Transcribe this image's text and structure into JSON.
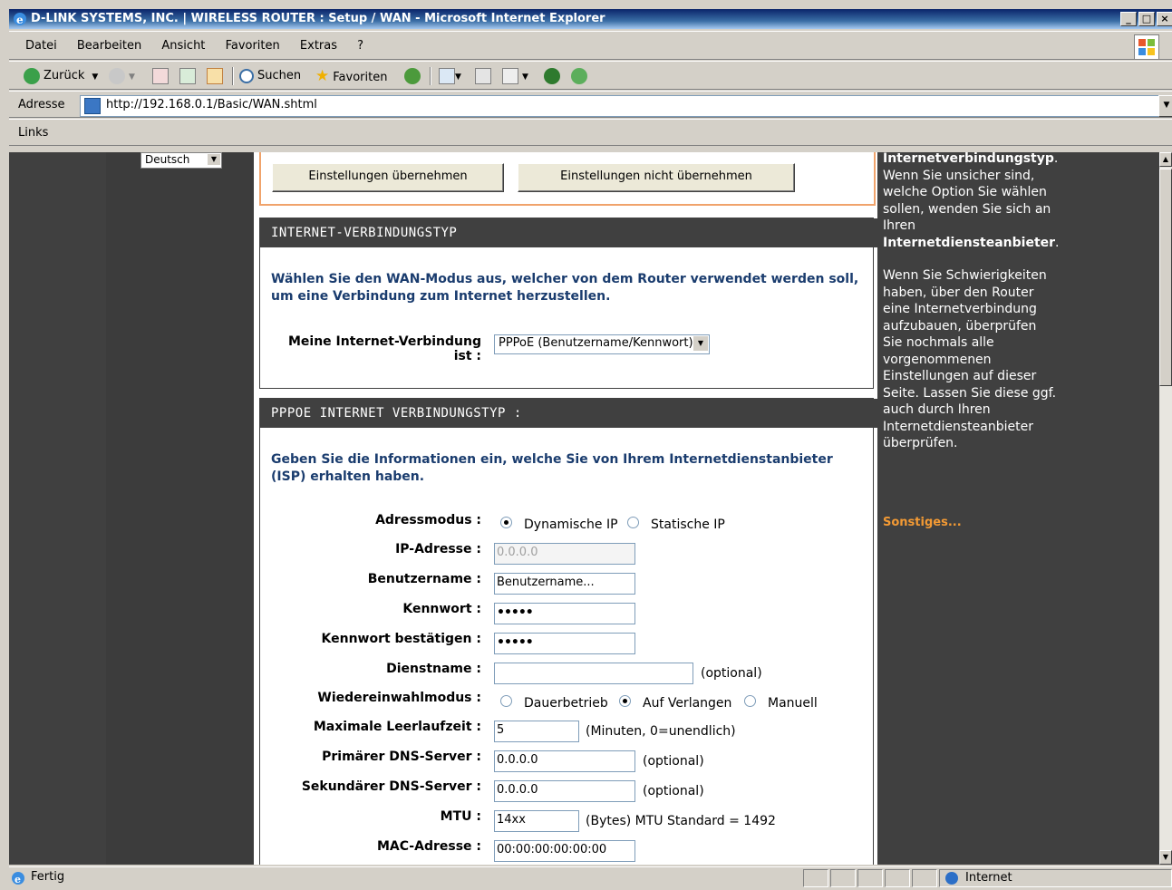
{
  "window": {
    "title": "D-LINK SYSTEMS, INC. | WIRELESS ROUTER : Setup / WAN - Microsoft Internet Explorer",
    "min_label": "_",
    "max_label": "□",
    "close_label": "×"
  },
  "menu": [
    "Datei",
    "Bearbeiten",
    "Ansicht",
    "Favoriten",
    "Extras",
    "?"
  ],
  "toolbar": {
    "back_label": "Zurück",
    "search_label": "Suchen",
    "favorites_label": "Favoriten"
  },
  "address": {
    "label": "Adresse",
    "url": "http://192.168.0.1/Basic/WAN.shtml"
  },
  "links": {
    "label": "Links"
  },
  "nav": {
    "language": "Deutsch"
  },
  "buttons": {
    "apply": "Einstellungen übernehmen",
    "cancel": "Einstellungen nicht übernehmen"
  },
  "wan_type": {
    "header": "INTERNET-VERBINDUNGSTYP",
    "intro": "Wählen Sie den WAN-Modus aus, welcher von dem Router verwendet werden soll, um eine Verbindung zum Internet herzustellen.",
    "connection_label_1": "Meine Internet-Verbindung",
    "connection_label_2": "ist :",
    "connection_value": "PPPoE (Benutzername/Kennwort)"
  },
  "pppoe": {
    "header": "PPPOE INTERNET VERBINDUNGSTYP :",
    "intro": "Geben Sie die Informationen ein, welche Sie von Ihrem Internetdienstanbieter (ISP) erhalten haben.",
    "address_mode": {
      "label": "Adressmodus :",
      "dynamic": "Dynamische IP",
      "static": "Statische IP",
      "selected": "dynamic"
    },
    "ip": {
      "label": "IP-Adresse :",
      "value": "0.0.0.0"
    },
    "username": {
      "label": "Benutzername :",
      "value": "Benutzername..."
    },
    "password": {
      "label": "Kennwort :",
      "value": "•••••"
    },
    "password_confirm": {
      "label": "Kennwort bestätigen :",
      "value": "•••••"
    },
    "service": {
      "label": "Dienstname :",
      "value": "",
      "note": "(optional)"
    },
    "reconnect": {
      "label": "Wiedereinwahlmodus :",
      "always": "Dauerbetrieb",
      "on_demand": "Auf Verlangen",
      "manual": "Manuell",
      "selected": "on_demand"
    },
    "idle": {
      "label": "Maximale Leerlaufzeit :",
      "value": "5",
      "note": "(Minuten, 0=unendlich)"
    },
    "dns1": {
      "label": "Primärer DNS-Server :",
      "value": "0.0.0.0",
      "note": "(optional)"
    },
    "dns2": {
      "label": "Sekundärer DNS-Server :",
      "value": "0.0.0.0",
      "note": "(optional)"
    },
    "mtu": {
      "label": "MTU :",
      "value": "14xx",
      "note": "(Bytes) MTU Standard = 1492"
    },
    "mac": {
      "label": "MAC-Adresse :",
      "value": "00:00:00:00:00:00"
    }
  },
  "help": {
    "p1_bold": "Internetverbindungstyp",
    "p1_text_a": ". Wenn Sie unsicher sind, welche Option Sie wählen sollen, wenden Sie sich an Ihren ",
    "p1_bold2": "Internetdiensteanbieter",
    "p1_text_b": ".",
    "p2": "Wenn Sie Schwierigkeiten haben, über den Router eine Internetverbindung aufzubauen, überprüfen Sie nochmals alle vorgenommenen Einstellungen auf dieser Seite. Lassen Sie diese ggf. auch durch Ihren Internetdiensteanbieter überprüfen.",
    "more": "Sonstiges..."
  },
  "status": {
    "text": "Fertig",
    "zone": "Internet"
  }
}
